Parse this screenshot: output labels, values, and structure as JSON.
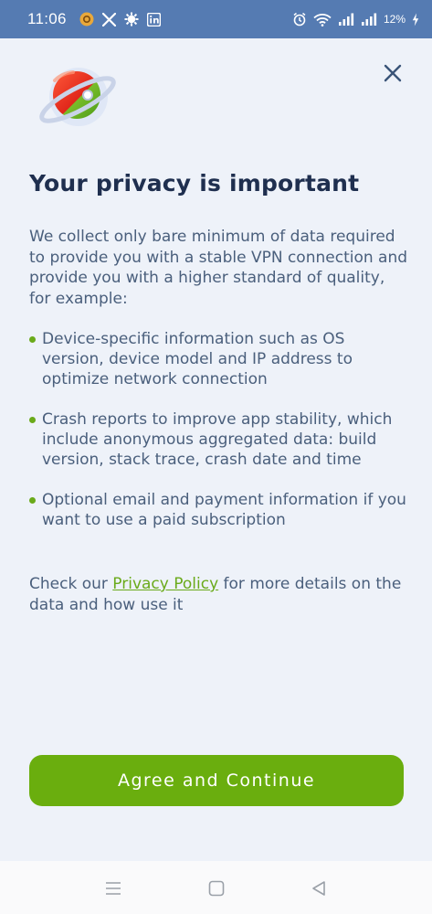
{
  "status_bar": {
    "time": "11:06",
    "battery": "12%",
    "left_icons": [
      "notification-app-icon",
      "x-icon",
      "gear-badge-icon",
      "linkedin-icon"
    ],
    "right_icons": [
      "alarm-icon",
      "wifi-icon",
      "signal-icon",
      "signal-icon",
      "charging-icon"
    ]
  },
  "dialog": {
    "title": "Your privacy is important",
    "intro": "We collect only bare minimum of data required to provide you with a stable VPN connection and provide you with a higher standard of quality, for example:",
    "bullets": [
      "Device-specific information such as OS version, device model and IP address to optimize network connection",
      "Crash reports to improve app stability, which include anonymous aggregated data: build version, stack trace, crash date and time",
      "Optional email and payment information if you want to use a paid subscription"
    ],
    "footer_before": "Check our ",
    "footer_link": "Privacy Policy",
    "footer_after": " for more details on the data and how use it",
    "cta_label": "Agree and Continue"
  },
  "colors": {
    "accent": "#6aae0e",
    "status_bar": "#557bb2",
    "title": "#1f2f4f",
    "body_text": "#4a5f7c",
    "background": "#eef2f9"
  },
  "nav": [
    "menu-icon",
    "home-icon",
    "back-icon"
  ]
}
